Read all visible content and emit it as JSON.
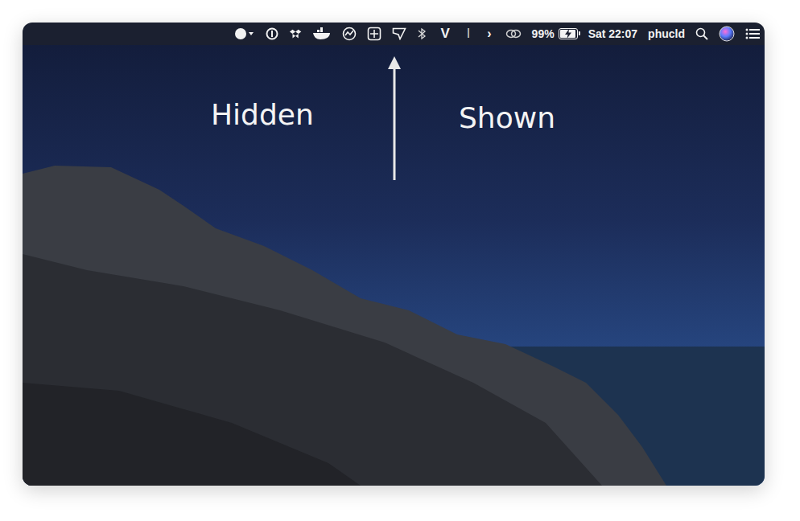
{
  "menu_bar": {
    "vanilla_glyph": "V",
    "separator_glyph": "I",
    "toggle_glyph": "›",
    "battery": {
      "reading": "99%",
      "level": 0.99,
      "charging": true
    },
    "clock": "Sat 22:07",
    "user": "phucld"
  },
  "annotations": {
    "left": "Hidden",
    "right": "Shown"
  }
}
